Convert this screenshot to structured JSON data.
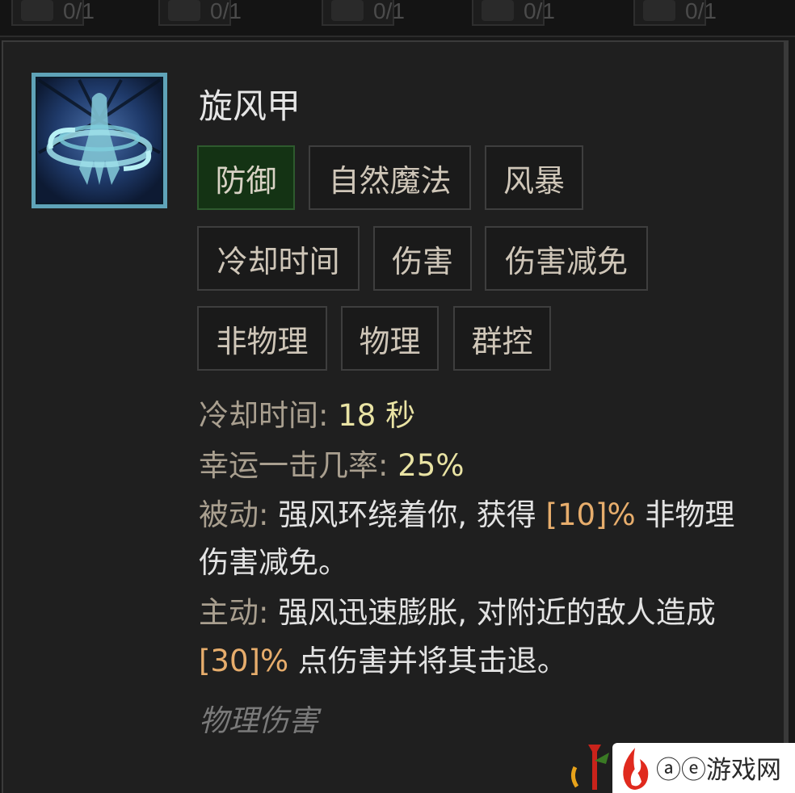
{
  "top_slots": [
    {
      "count": "0/1"
    },
    {
      "count": "0/1"
    },
    {
      "count": "0/1"
    },
    {
      "count": "0/1"
    },
    {
      "count": "0/1"
    }
  ],
  "skill": {
    "title": "旋风甲",
    "tags_row1": [
      "防御",
      "自然魔法",
      "风暴"
    ],
    "tags_row2": [
      "冷却时间",
      "伤害",
      "伤害减免"
    ],
    "tags_row3": [
      "非物理",
      "物理",
      "群控"
    ],
    "cooldown_label": "冷却时间:",
    "cooldown_value": "18 秒",
    "lucky_label": "幸运一击几率:",
    "lucky_value": "25%",
    "passive_label": "被动:",
    "passive_text_a": "强风环绕着你, 获得",
    "passive_value": "[10]%",
    "passive_text_b": "非物理",
    "passive_text_c": "伤害减免。",
    "active_label": "主动:",
    "active_text_a": "强风迅速膨胀, 对附近的敌人造成",
    "active_value": "[30]%",
    "active_text_b": "点伤害并将其击退。",
    "damage_type": "物理伤害"
  },
  "watermark": {
    "text": "ⓐⓔ游戏网"
  },
  "colors": {
    "background": "#1f1f1f",
    "active_tag": "#143314",
    "value_yellow": "#e9e3a4",
    "value_orange": "#e7ad6c"
  },
  "icons": {
    "skill_icon": "whirlwind-armor-icon",
    "watermark_logo": "flame-logo-icon"
  }
}
